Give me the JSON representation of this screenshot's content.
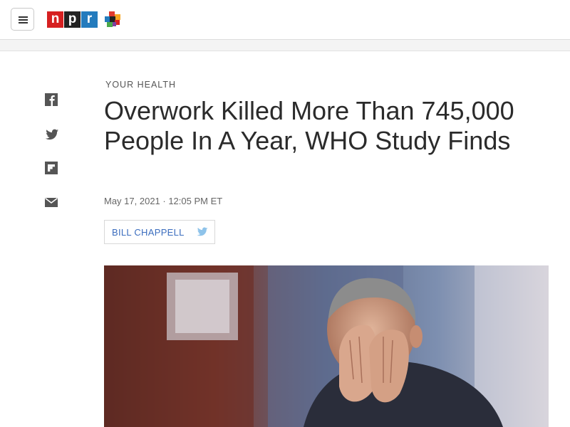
{
  "header": {
    "menu_icon": "hamburger-icon",
    "logo_letters": [
      "n",
      "p",
      "r"
    ],
    "brand_colors": {
      "n": "#d62021",
      "p": "#222222",
      "r": "#237bbd"
    },
    "cube_icon": "npr-one-cube-icon"
  },
  "share_rail": {
    "items": [
      {
        "icon": "facebook-icon"
      },
      {
        "icon": "twitter-icon"
      },
      {
        "icon": "flipboard-icon"
      },
      {
        "icon": "email-icon"
      }
    ]
  },
  "article": {
    "slug": "YOUR HEALTH",
    "headline": "Overwork Killed More Than 745,000 People In A Year, WHO Study Finds",
    "dateline": "May 17, 2021 · 12:05 PM ET",
    "byline": {
      "name": "BILL CHAPPELL",
      "social_icon": "twitter-icon"
    },
    "photo": {
      "subject": "man with hands over face",
      "icon": "photo-image"
    }
  },
  "colors": {
    "link": "#3b6dbe",
    "twitter": "#8ec3ea"
  }
}
